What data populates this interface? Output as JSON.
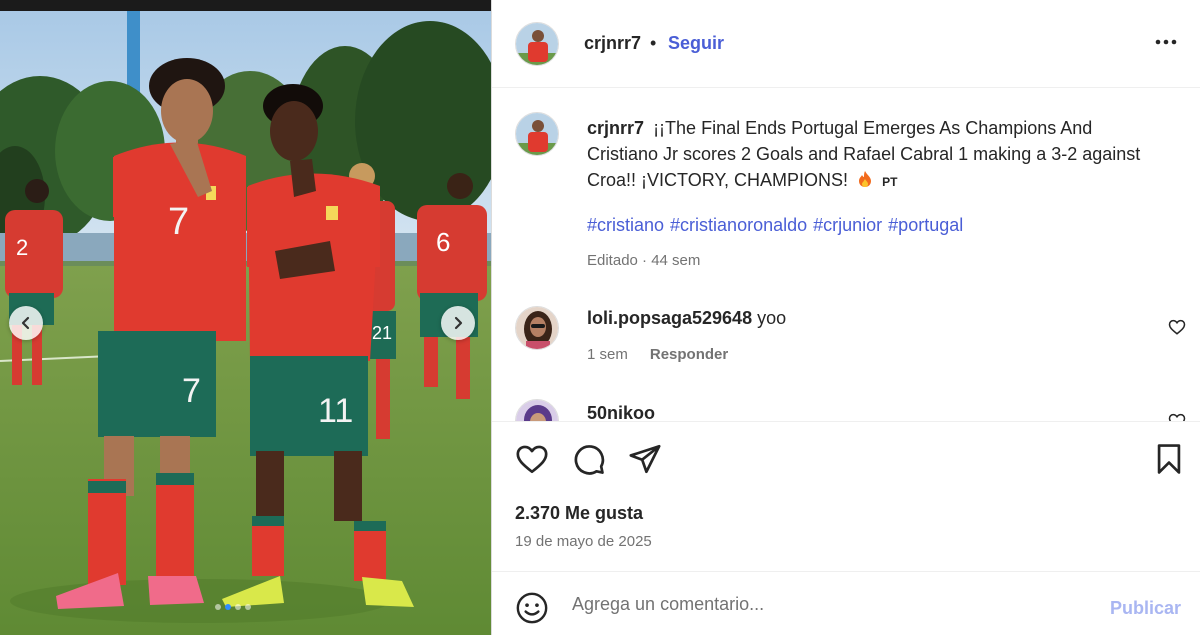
{
  "post": {
    "author": "crjnrr7",
    "follow_label": "Seguir",
    "separator": "•",
    "more_label": "•••",
    "caption_text": "¡¡The Final Ends Portugal Emerges As Champions And Cristiano Jr scores 2 Goals and Rafael Cabral 1 making a 3-2 against Croa!! ¡VICTORY, CHAMPIONS!",
    "caption_emoji": "fire-emoji",
    "caption_badge": "PT",
    "hashtags": [
      "#cristiano",
      "#cristianoronaldo",
      "#crjunior",
      "#portugal"
    ],
    "edited": "Editado · 44 sem",
    "likes": "2.370 Me gusta",
    "date": "19 de mayo de 2025",
    "carousel_slide": 2,
    "carousel_total": 4
  },
  "comments": [
    {
      "user": "loli.popsaga529648",
      "text": "yoo",
      "age": "1 sem",
      "reply_label": "Responder"
    },
    {
      "user": "50nikoo",
      "text": ""
    }
  ],
  "composer": {
    "placeholder": "Agrega un comentario...",
    "publish_label": "Publicar"
  },
  "photo": {
    "jersey_numbers": [
      "7",
      "11",
      "2",
      "6",
      "21"
    ]
  },
  "colors": {
    "accent_link": "#4a5ed6",
    "publish_disabled": "#a9b6f2",
    "muted_text": "#737373",
    "jersey_red": "#e03a2f",
    "shorts_green": "#1d6b57"
  },
  "icons": [
    "chevron-left-icon",
    "chevron-right-icon",
    "more-icon",
    "heart-icon",
    "comment-icon",
    "share-icon",
    "bookmark-icon",
    "emoji-icon",
    "fire-icon"
  ]
}
